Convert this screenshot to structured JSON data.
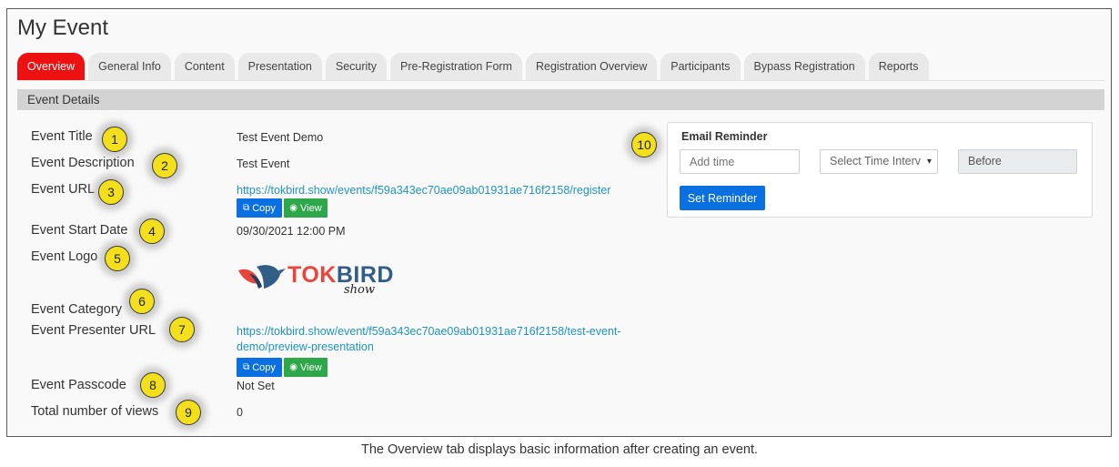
{
  "page": {
    "title": "My Event"
  },
  "tabs": [
    {
      "label": "Overview"
    },
    {
      "label": "General Info"
    },
    {
      "label": "Content"
    },
    {
      "label": "Presentation"
    },
    {
      "label": "Security"
    },
    {
      "label": "Pre-Registration Form"
    },
    {
      "label": "Registration Overview"
    },
    {
      "label": "Participants"
    },
    {
      "label": "Bypass Registration"
    },
    {
      "label": "Reports"
    }
  ],
  "section": {
    "title": "Event Details"
  },
  "details": {
    "title_label": "Event Title",
    "title_value": "Test Event Demo",
    "description_label": "Event Description",
    "description_value": "Test Event",
    "url_label": "Event URL",
    "url_value": "https://tokbird.show/events/f59a343ec70ae09ab01931ae716f2158/register",
    "start_label": "Event Start Date",
    "start_value": "09/30/2021 12:00 PM",
    "logo_label": "Event Logo",
    "category_label": "Event Category",
    "presenter_label": "Event Presenter URL",
    "presenter_value": "https://tokbird.show/event/f59a343ec70ae09ab01931ae716f2158/test-event-demo/preview-presentation",
    "passcode_label": "Event Passcode",
    "passcode_value": "Not Set",
    "views_label": "Total number of views",
    "views_value": "0"
  },
  "buttons": {
    "copy": "Copy",
    "view": "View"
  },
  "logo": {
    "tok": "TOK",
    "bird": "BIRD",
    "sub": "show"
  },
  "reminder": {
    "title": "Email Reminder",
    "time_placeholder": "Add time",
    "interval_selected": "Select Time Interv",
    "before": "Before",
    "set_button": "Set Reminder"
  },
  "badges": [
    "1",
    "2",
    "3",
    "4",
    "5",
    "6",
    "7",
    "8",
    "9",
    "10"
  ],
  "caption": "The Overview tab displays basic information after creating an event.",
  "colors": {
    "active_tab": "#ee1111",
    "primary_button": "#0a6fe0",
    "view_button": "#2ea64a",
    "link": "#1f93c0",
    "badge": "#f3df1b"
  },
  "icons": {
    "copy": "copy-icon",
    "view": "eye-icon",
    "select": "chevron-down-icon"
  }
}
